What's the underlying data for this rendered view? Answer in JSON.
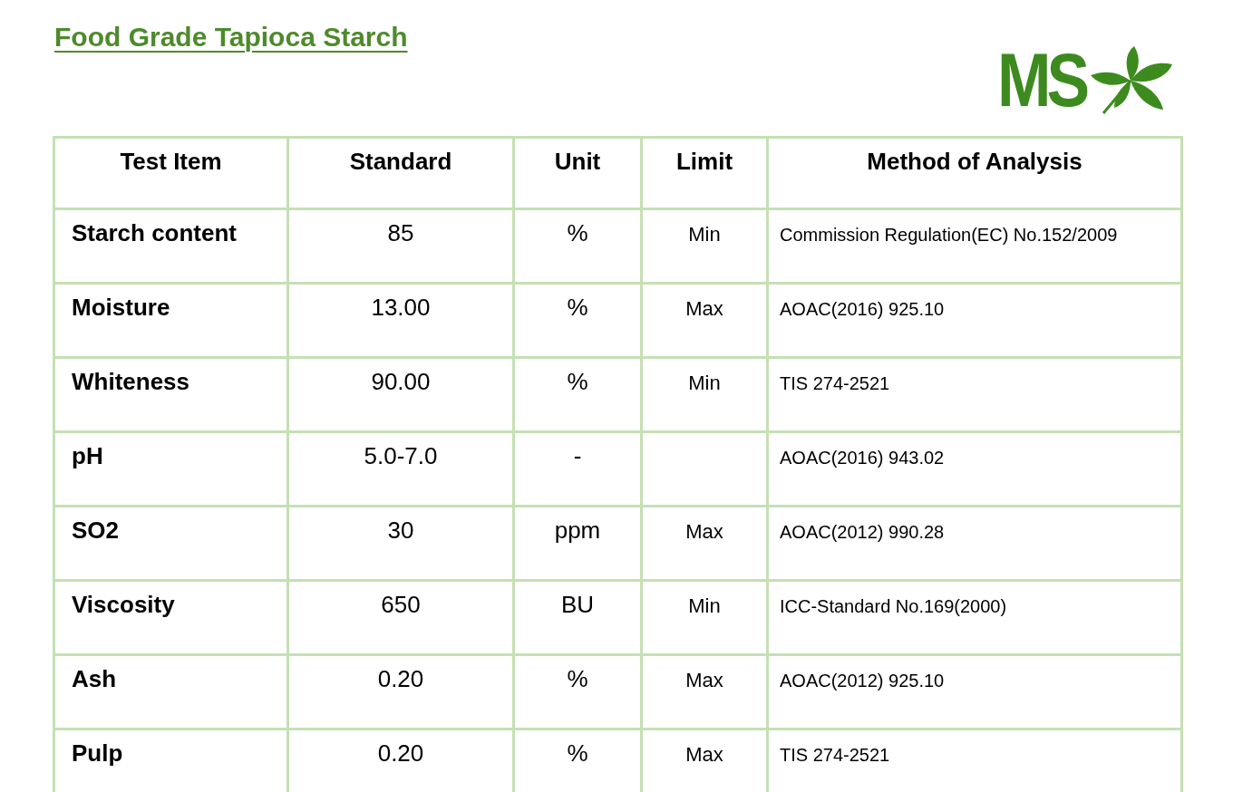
{
  "title": "Food Grade Tapioca Starch",
  "logo": {
    "text": "MS"
  },
  "table": {
    "columns": [
      "Test Item",
      "Standard",
      "Unit",
      "Limit",
      "Method of Analysis"
    ],
    "rows": [
      {
        "test_item": "Starch content",
        "standard": "85",
        "unit": "%",
        "limit": "Min",
        "method": "Commission Regulation(EC) No.152/2009"
      },
      {
        "test_item": "Moisture",
        "standard": "13.00",
        "unit": "%",
        "limit": "Max",
        "method": "AOAC(2016) 925.10"
      },
      {
        "test_item": "Whiteness",
        "standard": "90.00",
        "unit": "%",
        "limit": "Min",
        "method": "TIS 274-2521"
      },
      {
        "test_item": "pH",
        "standard": "5.0-7.0",
        "unit": "-",
        "limit": "",
        "method": "AOAC(2016) 943.02"
      },
      {
        "test_item": "SO2",
        "standard": "30",
        "unit": "ppm",
        "limit": "Max",
        "method": "AOAC(2012) 990.28"
      },
      {
        "test_item": "Viscosity",
        "standard": "650",
        "unit": "BU",
        "limit": "Min",
        "method": "ICC-Standard No.169(2000)"
      },
      {
        "test_item": "Ash",
        "standard": "0.20",
        "unit": "%",
        "limit": "Max",
        "method": "AOAC(2012) 925.10"
      },
      {
        "test_item": "Pulp",
        "standard": "0.20",
        "unit": "%",
        "limit": "Max",
        "method": "TIS 274-2521"
      }
    ]
  }
}
